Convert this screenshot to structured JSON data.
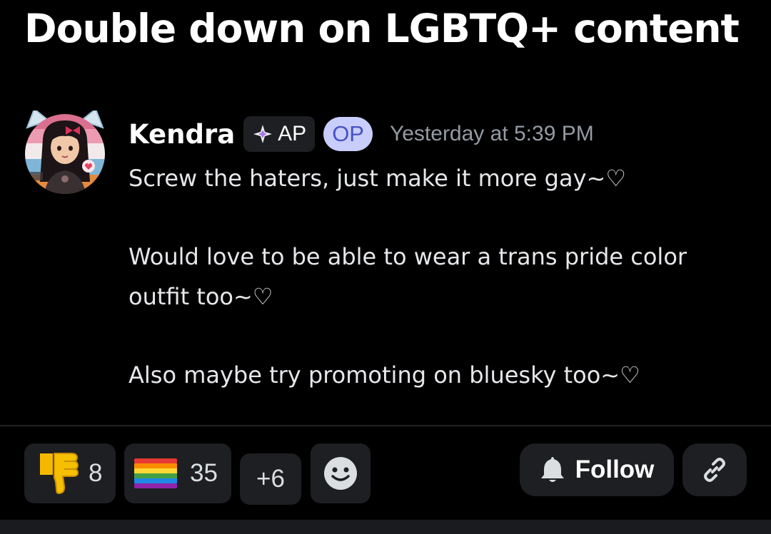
{
  "thread": {
    "title": "Double down on LGBTQ+ content"
  },
  "post": {
    "author": "Kendra",
    "role_badge": "AP",
    "op_badge": "OP",
    "timestamp": "Yesterday at 5:39 PM",
    "lines": [
      "Screw the haters, just make it more gay~♡",
      "Would love to be able to wear a trans pride color",
      "outfit too~♡",
      "Also maybe try promoting on bluesky too~♡"
    ]
  },
  "reactions": [
    {
      "emoji": "thumbs-down-icon",
      "count": "8"
    },
    {
      "emoji": "rainbow-flag-icon",
      "count": "35"
    }
  ],
  "more_reactions": "+6",
  "actions": {
    "follow_label": "Follow"
  },
  "colors": {
    "background": "#000000",
    "pill": "#1e1f22",
    "op_badge_bg": "#c9cdfb",
    "op_badge_text": "#4752c4",
    "muted_text": "#949ba4"
  }
}
